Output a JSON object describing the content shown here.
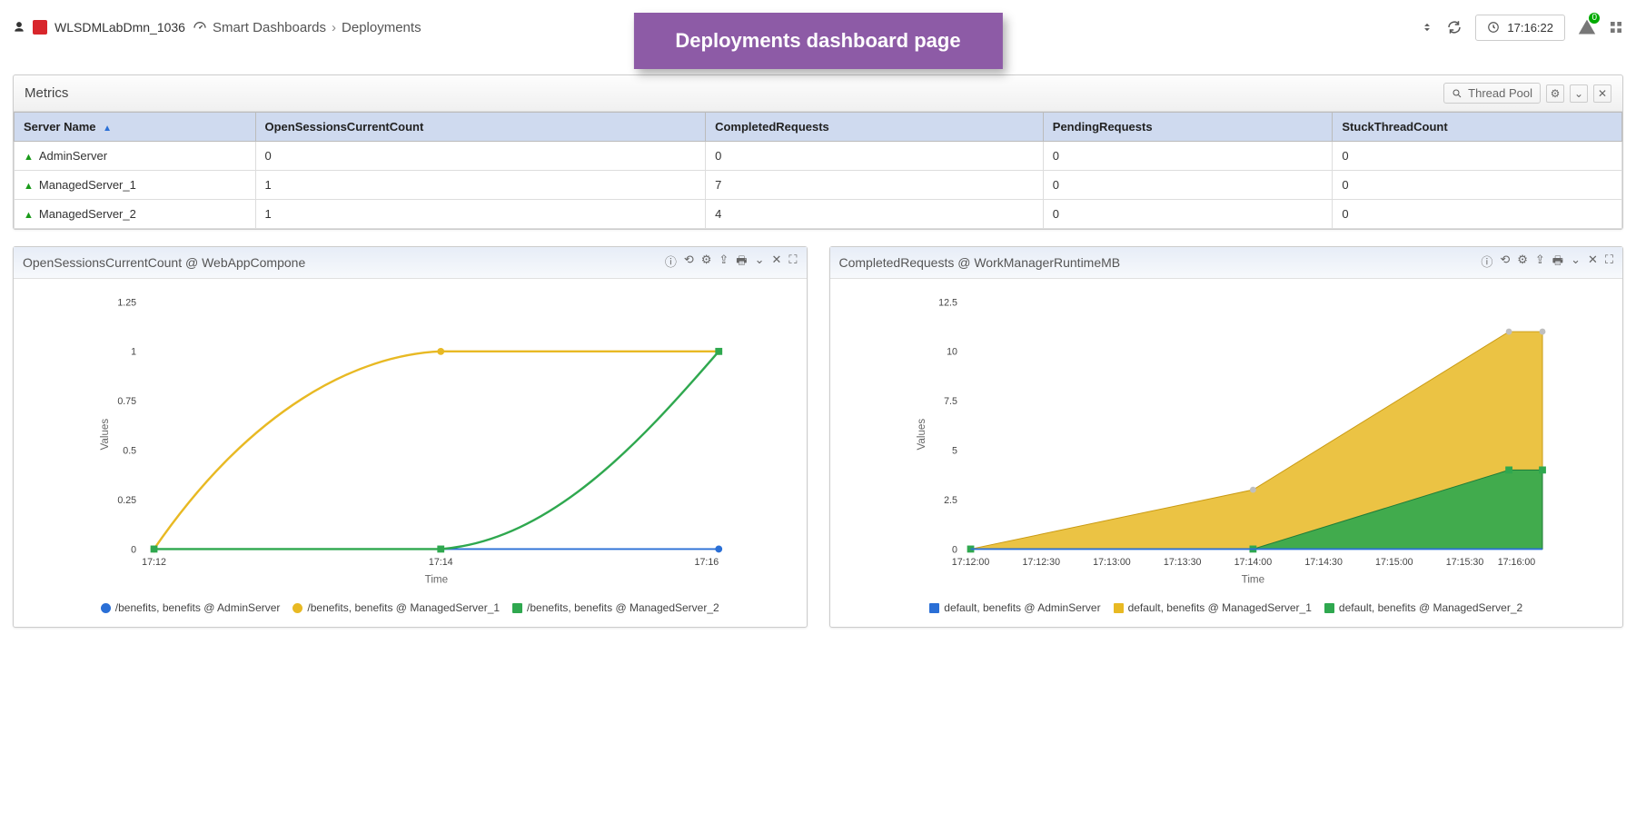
{
  "header": {
    "domain_label": "WLSDMLabDmn_1036",
    "breadcrumb": [
      "Smart Dashboards",
      "Deployments"
    ],
    "banner": "Deployments dashboard page",
    "clock": "17:16:22",
    "alert_count": "0"
  },
  "metrics_panel": {
    "title": "Metrics",
    "search_label": "Thread Pool",
    "columns": [
      "Server Name",
      "OpenSessionsCurrentCount",
      "CompletedRequests",
      "PendingRequests",
      "StuckThreadCount"
    ],
    "rows": [
      {
        "server": "AdminServer",
        "open": "0",
        "completed": "0",
        "pending": "0",
        "stuck": "0"
      },
      {
        "server": "ManagedServer_1",
        "open": "1",
        "completed": "7",
        "pending": "0",
        "stuck": "0"
      },
      {
        "server": "ManagedServer_2",
        "open": "1",
        "completed": "4",
        "pending": "0",
        "stuck": "0"
      }
    ]
  },
  "chart_left": {
    "title": "OpenSessionsCurrentCount @ WebAppCompone",
    "xlabel": "Time",
    "ylabel": "Values",
    "legend": [
      "/benefits, benefits @ AdminServer",
      "/benefits, benefits @ ManagedServer_1",
      "/benefits, benefits @ ManagedServer_2"
    ]
  },
  "chart_right": {
    "title": "CompletedRequests @ WorkManagerRuntimeMB",
    "xlabel": "Time",
    "ylabel": "Values",
    "legend": [
      "default, benefits @ AdminServer",
      "default, benefits @ ManagedServer_1",
      "default, benefits @ ManagedServer_2"
    ]
  },
  "colors": {
    "blue": "#2a6fd6",
    "yellow": "#e8b923",
    "green": "#2fa84f"
  },
  "chart_data": [
    {
      "type": "line",
      "title": "OpenSessionsCurrentCount @ WebAppCompone",
      "xlabel": "Time",
      "ylabel": "Values",
      "ylim": [
        0,
        1.25
      ],
      "x_ticks": [
        "17:12",
        "17:14",
        "17:16"
      ],
      "y_ticks": [
        0,
        0.25,
        0.5,
        0.75,
        1,
        1.25
      ],
      "categories": [
        "17:12",
        "17:14",
        "17:16"
      ],
      "series": [
        {
          "name": "/benefits, benefits @ AdminServer",
          "color": "#2a6fd6",
          "values": [
            0,
            0,
            0
          ]
        },
        {
          "name": "/benefits, benefits @ ManagedServer_1",
          "color": "#e8b923",
          "values": [
            0,
            1,
            1
          ]
        },
        {
          "name": "/benefits, benefits @ ManagedServer_2",
          "color": "#2fa84f",
          "values": [
            0,
            0,
            1
          ]
        }
      ]
    },
    {
      "type": "area",
      "title": "CompletedRequests @ WorkManagerRuntimeMB",
      "xlabel": "Time",
      "ylabel": "Values",
      "ylim": [
        0,
        12.5
      ],
      "x_ticks": [
        "17:12:00",
        "17:12:30",
        "17:13:00",
        "17:13:30",
        "17:14:00",
        "17:14:30",
        "17:15:00",
        "17:15:30",
        "17:16:00"
      ],
      "y_ticks": [
        0,
        2.5,
        5,
        7.5,
        10,
        12.5
      ],
      "categories": [
        "17:12:00",
        "17:14:00",
        "17:16:00",
        "17:16:20"
      ],
      "series": [
        {
          "name": "default, benefits @ AdminServer",
          "color": "#2a6fd6",
          "values": [
            0,
            0,
            0,
            0
          ]
        },
        {
          "name": "default, benefits @ ManagedServer_1",
          "color": "#e8b923",
          "values": [
            0,
            3,
            11,
            11
          ]
        },
        {
          "name": "default, benefits @ ManagedServer_2",
          "color": "#2fa84f",
          "values": [
            0,
            0,
            4,
            4
          ]
        }
      ]
    }
  ]
}
